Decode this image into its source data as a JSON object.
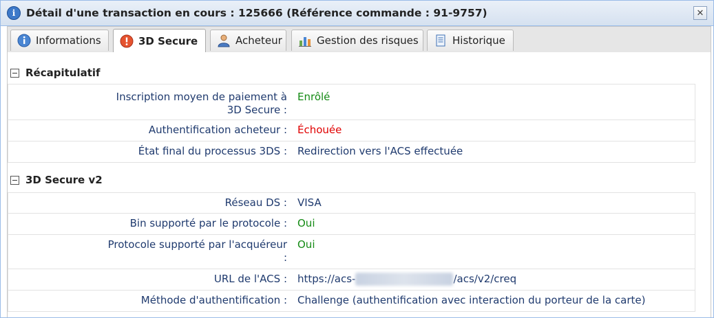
{
  "window": {
    "title": "Détail d'une transaction en cours : 125666 (Référence commande : 91-9757)",
    "close_glyph": "✕"
  },
  "tabs": [
    {
      "label": "Informations",
      "icon": "info-icon"
    },
    {
      "label": "3D Secure",
      "icon": "alert-icon",
      "active": true
    },
    {
      "label": "Acheteur",
      "icon": "user-icon"
    },
    {
      "label": "Gestion des risques",
      "icon": "chart-icon"
    },
    {
      "label": "Historique",
      "icon": "document-icon"
    }
  ],
  "recap": {
    "title": "Récapitulatif",
    "rows": [
      {
        "label": "Inscription moyen de paiement à",
        "label2": "3D Secure :",
        "value": "Enrôlé",
        "color": "#138a13"
      },
      {
        "label": "Authentification acheteur :",
        "value": "Échouée",
        "color": "#e00000"
      },
      {
        "label": "État final du processus 3DS :",
        "value": "Redirection vers l'ACS effectuée",
        "color": "#1f3a6e"
      }
    ]
  },
  "v2": {
    "title": "3D Secure v2",
    "rows": [
      {
        "label": "Réseau DS :",
        "value": "VISA"
      },
      {
        "label": "Bin supporté par le protocole :",
        "value": "Oui",
        "color": "#138a13"
      },
      {
        "label": "Protocole supporté par l'acquéreur",
        "label2": ":",
        "value": "Oui",
        "color": "#138a13"
      },
      {
        "label": "URL de l'ACS :",
        "value_prefix": "https://acs-",
        "value_suffix": "/acs/v2/creq"
      },
      {
        "label": "Méthode d'authentification :",
        "value": "Challenge (authentification avec interaction du porteur de la carte)"
      }
    ]
  }
}
